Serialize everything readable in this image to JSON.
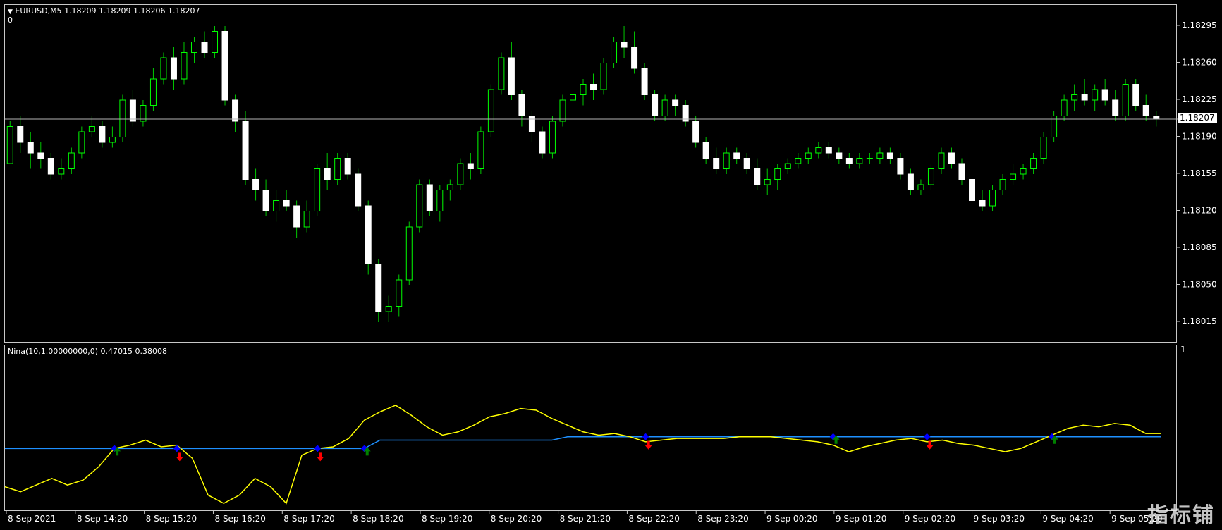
{
  "main": {
    "header_symbol": "EURUSD,M5",
    "header_ohlc": "1.18209 1.18209 1.18206 1.18207",
    "header_zero": "0",
    "current_price": "1.18207",
    "price_axis": [
      "1.18295",
      "1.18260",
      "1.18225",
      "1.18190",
      "1.18155",
      "1.18120",
      "1.18085",
      "1.18050",
      "1.18015"
    ]
  },
  "indicator": {
    "header": "Nina(10,1.00000000,0) 0.47015 0.38008",
    "scale_top": "1"
  },
  "time_axis": [
    "8 Sep 2021",
    "8 Sep 14:20",
    "8 Sep 15:20",
    "8 Sep 16:20",
    "8 Sep 17:20",
    "8 Sep 18:20",
    "8 Sep 19:20",
    "8 Sep 20:20",
    "8 Sep 21:20",
    "8 Sep 22:20",
    "8 Sep 23:20",
    "9 Sep 00:20",
    "9 Sep 01:20",
    "9 Sep 02:20",
    "9 Sep 03:20",
    "9 Sep 04:20",
    "9 Sep 05:20"
  ],
  "watermark": "指标铺",
  "colors": {
    "bull": "#ffffff",
    "bear": "#00ff00",
    "wick": "#00c800",
    "indicator_line": "#ffff00",
    "signal_line": "#1e90ff",
    "arrow_up": "#008000",
    "arrow_down": "#ff0000",
    "cross_marker": "#0000ff"
  },
  "chart_data": [
    {
      "type": "candlestick",
      "title": "EURUSD,M5",
      "ylim": [
        1.17995,
        1.18315
      ],
      "y_ticks": [
        1.18295,
        1.1826,
        1.18225,
        1.1819,
        1.18155,
        1.1812,
        1.18085,
        1.1805,
        1.18015
      ],
      "candles": [
        [
          1.18165,
          1.18205,
          1.18165,
          1.182
        ],
        [
          1.182,
          1.1821,
          1.18175,
          1.18185
        ],
        [
          1.18185,
          1.18195,
          1.1816,
          1.18175
        ],
        [
          1.18175,
          1.18185,
          1.1816,
          1.1817
        ],
        [
          1.1817,
          1.18175,
          1.1815,
          1.18155
        ],
        [
          1.18155,
          1.1817,
          1.1815,
          1.1816
        ],
        [
          1.1816,
          1.1818,
          1.18155,
          1.18175
        ],
        [
          1.18175,
          1.182,
          1.1817,
          1.18195
        ],
        [
          1.18195,
          1.1821,
          1.1819,
          1.182
        ],
        [
          1.182,
          1.18205,
          1.1818,
          1.18185
        ],
        [
          1.18185,
          1.182,
          1.1818,
          1.1819
        ],
        [
          1.1819,
          1.1823,
          1.18185,
          1.18225
        ],
        [
          1.18225,
          1.18235,
          1.182,
          1.18205
        ],
        [
          1.18205,
          1.18225,
          1.182,
          1.1822
        ],
        [
          1.1822,
          1.18255,
          1.18215,
          1.18245
        ],
        [
          1.18245,
          1.1827,
          1.1824,
          1.18265
        ],
        [
          1.18265,
          1.18275,
          1.18235,
          1.18245
        ],
        [
          1.18245,
          1.1828,
          1.1824,
          1.1827
        ],
        [
          1.1827,
          1.18285,
          1.1826,
          1.1828
        ],
        [
          1.1828,
          1.1829,
          1.18265,
          1.1827
        ],
        [
          1.1827,
          1.18295,
          1.18265,
          1.1829
        ],
        [
          1.1829,
          1.18295,
          1.1822,
          1.18225
        ],
        [
          1.18225,
          1.1823,
          1.18195,
          1.18205
        ],
        [
          1.18205,
          1.18215,
          1.18145,
          1.1815
        ],
        [
          1.1815,
          1.1816,
          1.1813,
          1.1814
        ],
        [
          1.1814,
          1.1815,
          1.18115,
          1.1812
        ],
        [
          1.1812,
          1.1814,
          1.1811,
          1.1813
        ],
        [
          1.1813,
          1.1814,
          1.1812,
          1.18125
        ],
        [
          1.18125,
          1.1813,
          1.18095,
          1.18105
        ],
        [
          1.18105,
          1.1813,
          1.181,
          1.1812
        ],
        [
          1.1812,
          1.18165,
          1.18115,
          1.1816
        ],
        [
          1.1816,
          1.18175,
          1.1814,
          1.1815
        ],
        [
          1.1815,
          1.18175,
          1.18145,
          1.1817
        ],
        [
          1.1817,
          1.18175,
          1.1815,
          1.18155
        ],
        [
          1.18155,
          1.1816,
          1.1812,
          1.18125
        ],
        [
          1.18125,
          1.1813,
          1.1806,
          1.1807
        ],
        [
          1.1807,
          1.18075,
          1.18015,
          1.18025
        ],
        [
          1.18025,
          1.1804,
          1.18015,
          1.1803
        ],
        [
          1.1803,
          1.1806,
          1.1802,
          1.18055
        ],
        [
          1.18055,
          1.1811,
          1.1805,
          1.18105
        ],
        [
          1.18105,
          1.1815,
          1.181,
          1.18145
        ],
        [
          1.18145,
          1.1815,
          1.18115,
          1.1812
        ],
        [
          1.1812,
          1.18145,
          1.1811,
          1.1814
        ],
        [
          1.1814,
          1.1815,
          1.1813,
          1.18145
        ],
        [
          1.18145,
          1.1817,
          1.1814,
          1.18165
        ],
        [
          1.18165,
          1.18175,
          1.1815,
          1.1816
        ],
        [
          1.1816,
          1.182,
          1.18155,
          1.18195
        ],
        [
          1.18195,
          1.1824,
          1.1819,
          1.18235
        ],
        [
          1.18235,
          1.1827,
          1.1823,
          1.18265
        ],
        [
          1.18265,
          1.1828,
          1.18225,
          1.1823
        ],
        [
          1.1823,
          1.18235,
          1.182,
          1.1821
        ],
        [
          1.1821,
          1.18215,
          1.18185,
          1.18195
        ],
        [
          1.18195,
          1.182,
          1.1817,
          1.18175
        ],
        [
          1.18175,
          1.1821,
          1.1817,
          1.18205
        ],
        [
          1.18205,
          1.1823,
          1.182,
          1.18225
        ],
        [
          1.18225,
          1.1824,
          1.18215,
          1.1823
        ],
        [
          1.1823,
          1.18245,
          1.1822,
          1.1824
        ],
        [
          1.1824,
          1.1825,
          1.18225,
          1.18235
        ],
        [
          1.18235,
          1.18265,
          1.1823,
          1.1826
        ],
        [
          1.1826,
          1.18285,
          1.18255,
          1.1828
        ],
        [
          1.1828,
          1.18295,
          1.18265,
          1.18275
        ],
        [
          1.18275,
          1.1829,
          1.1825,
          1.18255
        ],
        [
          1.18255,
          1.1826,
          1.18225,
          1.1823
        ],
        [
          1.1823,
          1.18235,
          1.18205,
          1.1821
        ],
        [
          1.1821,
          1.1823,
          1.18205,
          1.18225
        ],
        [
          1.18225,
          1.1823,
          1.1821,
          1.1822
        ],
        [
          1.1822,
          1.18225,
          1.182,
          1.18205
        ],
        [
          1.18205,
          1.1821,
          1.1818,
          1.18185
        ],
        [
          1.18185,
          1.1819,
          1.18165,
          1.1817
        ],
        [
          1.1817,
          1.1818,
          1.18155,
          1.1816
        ],
        [
          1.1816,
          1.1818,
          1.18155,
          1.18175
        ],
        [
          1.18175,
          1.1818,
          1.18165,
          1.1817
        ],
        [
          1.1817,
          1.18175,
          1.18155,
          1.1816
        ],
        [
          1.1816,
          1.1817,
          1.1814,
          1.18145
        ],
        [
          1.18145,
          1.1816,
          1.18135,
          1.1815
        ],
        [
          1.1815,
          1.18165,
          1.1814,
          1.1816
        ],
        [
          1.1816,
          1.1817,
          1.18155,
          1.18165
        ],
        [
          1.18165,
          1.18175,
          1.1816,
          1.1817
        ],
        [
          1.1817,
          1.1818,
          1.18165,
          1.18175
        ],
        [
          1.18175,
          1.18185,
          1.1817,
          1.1818
        ],
        [
          1.1818,
          1.18185,
          1.1817,
          1.18175
        ],
        [
          1.18175,
          1.1818,
          1.18165,
          1.1817
        ],
        [
          1.1817,
          1.18175,
          1.1816,
          1.18165
        ],
        [
          1.18165,
          1.18175,
          1.1816,
          1.1817
        ],
        [
          1.1817,
          1.18175,
          1.18165,
          1.1817
        ],
        [
          1.1817,
          1.1818,
          1.18165,
          1.18175
        ],
        [
          1.18175,
          1.1818,
          1.18165,
          1.1817
        ],
        [
          1.1817,
          1.18175,
          1.1815,
          1.18155
        ],
        [
          1.18155,
          1.1816,
          1.18135,
          1.1814
        ],
        [
          1.1814,
          1.1815,
          1.18135,
          1.18145
        ],
        [
          1.18145,
          1.18165,
          1.1814,
          1.1816
        ],
        [
          1.1816,
          1.1818,
          1.18155,
          1.18175
        ],
        [
          1.18175,
          1.1818,
          1.1816,
          1.18165
        ],
        [
          1.18165,
          1.1817,
          1.18145,
          1.1815
        ],
        [
          1.1815,
          1.18155,
          1.18125,
          1.1813
        ],
        [
          1.1813,
          1.1814,
          1.1812,
          1.18125
        ],
        [
          1.18125,
          1.18145,
          1.1812,
          1.1814
        ],
        [
          1.1814,
          1.18155,
          1.18135,
          1.1815
        ],
        [
          1.1815,
          1.18165,
          1.18145,
          1.18155
        ],
        [
          1.18155,
          1.18165,
          1.1815,
          1.1816
        ],
        [
          1.1816,
          1.18175,
          1.18155,
          1.1817
        ],
        [
          1.1817,
          1.18195,
          1.18165,
          1.1819
        ],
        [
          1.1819,
          1.18215,
          1.18185,
          1.1821
        ],
        [
          1.1821,
          1.1823,
          1.18205,
          1.18225
        ],
        [
          1.18225,
          1.1824,
          1.18215,
          1.1823
        ],
        [
          1.1823,
          1.18245,
          1.1822,
          1.18225
        ],
        [
          1.18225,
          1.1824,
          1.18215,
          1.18235
        ],
        [
          1.18235,
          1.18245,
          1.1822,
          1.18225
        ],
        [
          1.18225,
          1.18235,
          1.18205,
          1.1821
        ],
        [
          1.1821,
          1.18245,
          1.18205,
          1.1824
        ],
        [
          1.1824,
          1.18245,
          1.18215,
          1.1822
        ],
        [
          1.1822,
          1.1823,
          1.18205,
          1.1821
        ],
        [
          1.1821,
          1.18215,
          1.182,
          1.18207
        ]
      ]
    },
    {
      "type": "line",
      "title": "Nina(10,1.00000000,0) 0.47015 0.38008",
      "ylim": [
        0,
        1
      ],
      "series": [
        {
          "values": [
            0.15,
            0.12,
            0.16,
            0.2,
            0.16,
            0.19,
            0.27,
            0.38,
            0.4,
            0.43,
            0.39,
            0.4,
            0.32,
            0.1,
            0.05,
            0.1,
            0.2,
            0.15,
            0.05,
            0.34,
            0.38,
            0.39,
            0.44,
            0.55,
            0.6,
            0.64,
            0.58,
            0.51,
            0.46,
            0.48,
            0.52,
            0.57,
            0.59,
            0.62,
            0.61,
            0.56,
            0.52,
            0.48,
            0.46,
            0.47,
            0.45,
            0.42,
            0.43,
            0.44,
            0.44,
            0.44,
            0.44,
            0.45,
            0.45,
            0.45,
            0.44,
            0.43,
            0.42,
            0.4,
            0.36,
            0.39,
            0.41,
            0.43,
            0.44,
            0.42,
            0.43,
            0.41,
            0.4,
            0.38,
            0.36,
            0.38,
            0.42,
            0.46,
            0.5,
            0.52,
            0.51,
            0.53,
            0.52,
            0.47,
            0.47
          ]
        },
        {
          "values": [
            0.38,
            0.38,
            0.38,
            0.38,
            0.38,
            0.38,
            0.38,
            0.38,
            0.38,
            0.38,
            0.38,
            0.38,
            0.38,
            0.38,
            0.38,
            0.38,
            0.38,
            0.38,
            0.38,
            0.38,
            0.38,
            0.38,
            0.38,
            0.38,
            0.43,
            0.43,
            0.43,
            0.43,
            0.43,
            0.43,
            0.43,
            0.43,
            0.43,
            0.43,
            0.43,
            0.43,
            0.45,
            0.45,
            0.45,
            0.45,
            0.45,
            0.45,
            0.45,
            0.45,
            0.45,
            0.45,
            0.45,
            0.45,
            0.45,
            0.45,
            0.45,
            0.45,
            0.45,
            0.45,
            0.45,
            0.45,
            0.45,
            0.45,
            0.45,
            0.45,
            0.45,
            0.45,
            0.45,
            0.45,
            0.45,
            0.45,
            0.45,
            0.45,
            0.45,
            0.45,
            0.45,
            0.45,
            0.45,
            0.45,
            0.45
          ]
        }
      ],
      "signals": [
        {
          "i": 7,
          "kind": "up"
        },
        {
          "i": 11,
          "kind": "down"
        },
        {
          "i": 20,
          "kind": "down"
        },
        {
          "i": 23,
          "kind": "up"
        },
        {
          "i": 41,
          "kind": "down"
        },
        {
          "i": 53,
          "kind": "up"
        },
        {
          "i": 59,
          "kind": "down"
        },
        {
          "i": 67,
          "kind": "up"
        }
      ]
    }
  ]
}
